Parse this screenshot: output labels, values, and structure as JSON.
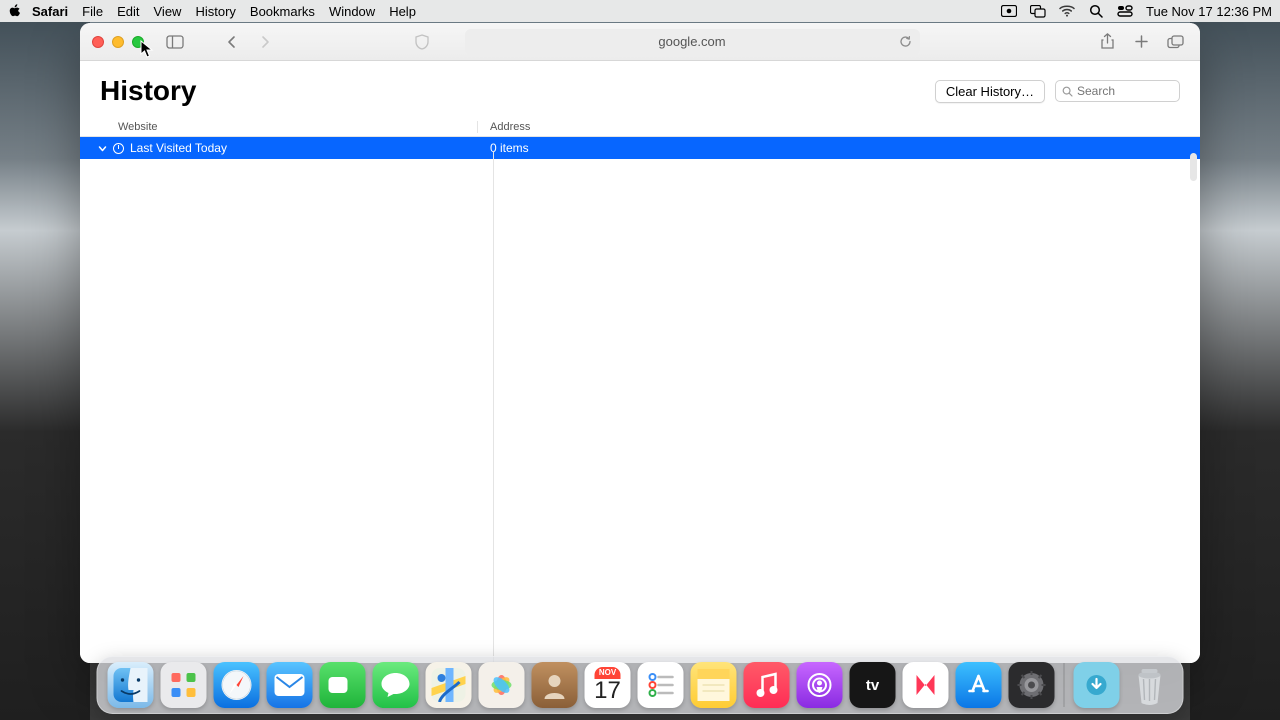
{
  "menubar": {
    "app_title": "Safari",
    "items": [
      "File",
      "Edit",
      "View",
      "History",
      "Bookmarks",
      "Window",
      "Help"
    ],
    "clock": "Tue Nov 17  12:36 PM"
  },
  "toolbar": {
    "address": "google.com"
  },
  "history": {
    "title": "History",
    "clear_label": "Clear History…",
    "search_placeholder": "Search",
    "col_website": "Website",
    "col_address": "Address",
    "group_label": "Last Visited Today",
    "group_count": "0 items"
  },
  "dock": {
    "calendar_month": "NOV",
    "calendar_day": "17"
  }
}
